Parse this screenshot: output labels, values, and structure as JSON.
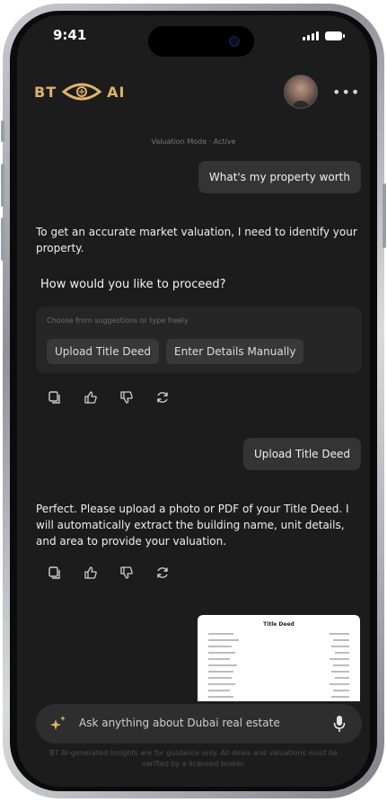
{
  "status_bar": {
    "time": "9:41"
  },
  "header": {
    "logo_left": "BT",
    "logo_right": "AI"
  },
  "mode_indicator": "Valuation Mode · Active",
  "chat": {
    "user_msg_1": "What's my property worth",
    "ai_msg_1": "To get an accurate market valuation, I need to identify your property.",
    "question": "How would you like to proceed?",
    "suggestions": {
      "hint": "Choose from suggestions or type freely",
      "chips": [
        "Upload Title Deed",
        "Enter Details Manually"
      ]
    },
    "user_msg_2": "Upload Title Deed",
    "ai_msg_2": "Perfect. Please upload a photo or PDF of your Title Deed. I will automatically extract the building name, unit details, and area to provide your valuation.",
    "attachment": {
      "title": "Title Deed"
    }
  },
  "composer": {
    "placeholder": "Ask anything about Dubai real estate"
  },
  "footer": {
    "disclaimer": "BT AI-generated insights are for guidance only. All deals and valuations must be verified by a licensed broker."
  },
  "colors": {
    "accent": "#ddb36a",
    "background": "#1c1c1c",
    "bubble": "#343434"
  }
}
